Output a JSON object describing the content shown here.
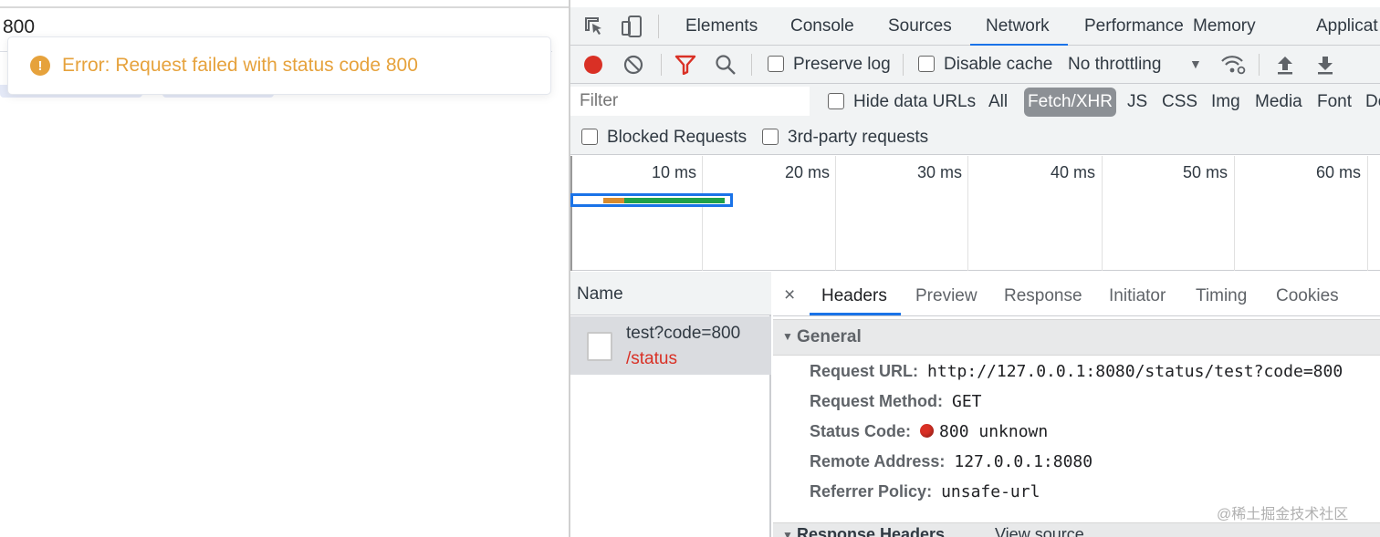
{
  "page": {
    "input_value": "800",
    "toast": {
      "icon": "!",
      "message": "Error: Request failed with status code 800",
      "color": "#e6a23c"
    }
  },
  "devtools": {
    "tabs": [
      "Elements",
      "Console",
      "Sources",
      "Network",
      "Performance",
      "Memory",
      "Applicat"
    ],
    "active_tab": "Network",
    "toolbar": {
      "preserve_log": "Preserve log",
      "disable_cache": "Disable cache",
      "throttling": "No throttling"
    },
    "filter": {
      "placeholder": "Filter",
      "hide_data_urls": "Hide data URLs",
      "types": [
        "All",
        "Fetch/XHR",
        "JS",
        "CSS",
        "Img",
        "Media",
        "Font",
        "Do"
      ],
      "active_type": "Fetch/XHR",
      "blocked_requests": "Blocked Requests",
      "third_party": "3rd-party requests"
    },
    "timeline": {
      "ticks": [
        "10 ms",
        "20 ms",
        "30 ms",
        "40 ms",
        "50 ms",
        "60 ms"
      ]
    },
    "requests": {
      "header": "Name",
      "items": [
        {
          "name": "test?code=800",
          "path": "/status"
        }
      ]
    },
    "details": {
      "close": "×",
      "tabs": [
        "Headers",
        "Preview",
        "Response",
        "Initiator",
        "Timing",
        "Cookies"
      ],
      "active_tab": "Headers",
      "general": {
        "title": "General",
        "request_url_label": "Request URL:",
        "request_url": "http://127.0.0.1:8080/status/test?code=800",
        "request_method_label": "Request Method:",
        "request_method": "GET",
        "status_code_label": "Status Code:",
        "status_code": "800 unknown",
        "remote_address_label": "Remote Address:",
        "remote_address": "127.0.0.1:8080",
        "referrer_policy_label": "Referrer Policy:",
        "referrer_policy": "unsafe-url"
      },
      "response_headers": {
        "title": "Response Headers",
        "view_source": "View source"
      }
    }
  },
  "watermark": "@稀土掘金技术社区"
}
